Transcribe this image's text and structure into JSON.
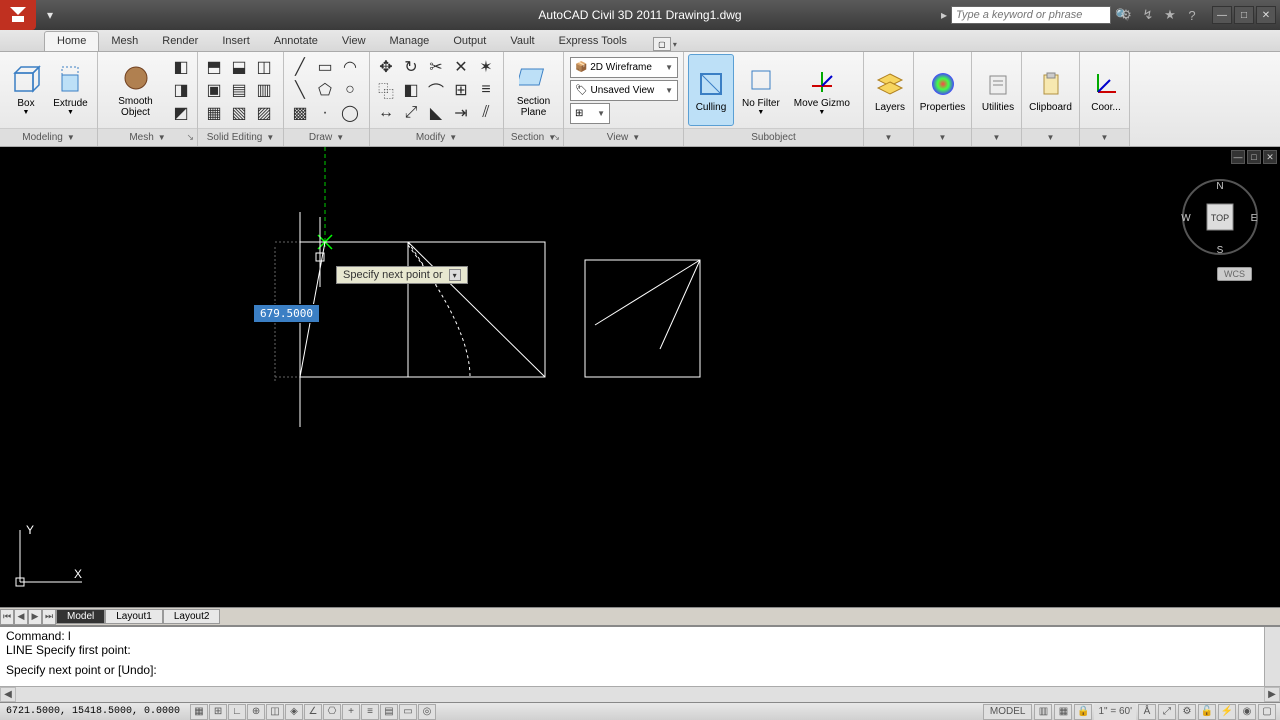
{
  "app": {
    "title": "AutoCAD Civil 3D 2011   Drawing1.dwg",
    "search_placeholder": "Type a keyword or phrase"
  },
  "tabs": {
    "items": [
      "Home",
      "Mesh",
      "Render",
      "Insert",
      "Annotate",
      "View",
      "Manage",
      "Output",
      "Vault",
      "Express Tools"
    ],
    "active": 0
  },
  "ribbon": {
    "modeling": {
      "label": "Modeling",
      "box": "Box",
      "extrude": "Extrude",
      "smooth": "Smooth Object"
    },
    "mesh": {
      "label": "Mesh"
    },
    "solid_editing": {
      "label": "Solid Editing"
    },
    "draw": {
      "label": "Draw"
    },
    "modify": {
      "label": "Modify"
    },
    "section": {
      "label": "Section",
      "plane": "Section Plane"
    },
    "view": {
      "label": "View",
      "visual": "2D Wireframe",
      "named": "Unsaved View"
    },
    "selection": {
      "culling": "Culling",
      "nofilter": "No Filter",
      "gizmo": "Move Gizmo"
    },
    "layers": "Layers",
    "properties": "Properties",
    "utilities": "Utilities",
    "clipboard": "Clipboard",
    "coord": "Coor...",
    "subobject": "Subobject"
  },
  "canvas": {
    "dyn_input": "679.5000",
    "prompt": "Specify next point or",
    "wcs": "WCS",
    "compass": {
      "n": "N",
      "s": "S",
      "e": "E",
      "w": "W",
      "top": "TOP"
    }
  },
  "layout_tabs": {
    "items": [
      "Model",
      "Layout1",
      "Layout2"
    ],
    "active": 0
  },
  "cmd": {
    "line1": "Command: l",
    "line2": "LINE Specify first point:",
    "line3": "Specify next point or [Undo]:"
  },
  "status": {
    "coords": "6721.5000, 15418.5000, 0.0000",
    "model": "MODEL",
    "scale": "1\" = 60'"
  }
}
